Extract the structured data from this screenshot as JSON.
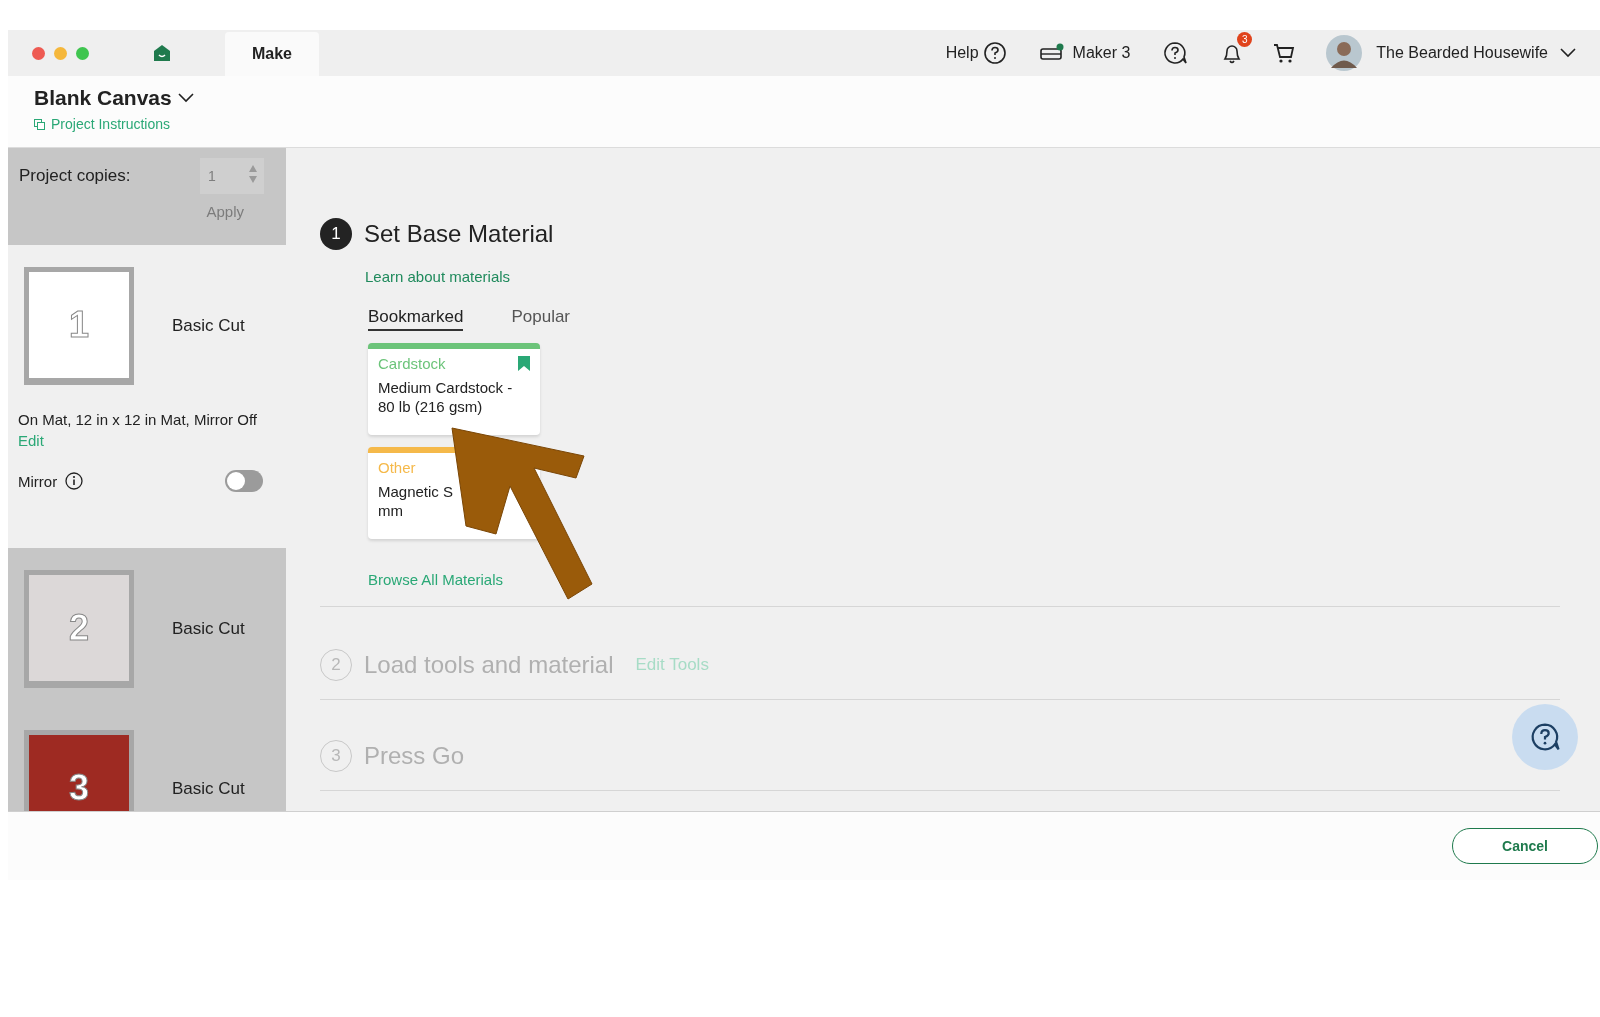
{
  "window": {
    "tabs": [
      {
        "label": "Make",
        "selected": true
      }
    ]
  },
  "top_bar": {
    "help": "Help",
    "machine": {
      "name": "Maker 3",
      "connected": true
    },
    "notifications": "3",
    "user": "The Bearded Housewife"
  },
  "project": {
    "title": "Blank Canvas",
    "instructions_link": "Project Instructions"
  },
  "sidebar": {
    "copies_label": "Project copies:",
    "copies_value": "1",
    "apply": "Apply",
    "apply_disabled": true,
    "mats": [
      {
        "number": "1",
        "label": "Basic Cut",
        "selected": true,
        "color": "#ffffff",
        "details": "On Mat, 12 in x 12 in Mat, Mirror Off",
        "edit": "Edit",
        "mirror_label": "Mirror",
        "mirror_on": false
      },
      {
        "number": "2",
        "label": "Basic Cut",
        "selected": false,
        "color": "#dcd8d8"
      },
      {
        "number": "3",
        "label": "Basic Cut",
        "selected": false,
        "color": "#9e2a22"
      }
    ]
  },
  "steps": [
    {
      "number": "1",
      "title": "Set Base Material",
      "active": true,
      "link": "Learn about materials"
    },
    {
      "number": "2",
      "title": "Load tools and material",
      "active": false,
      "link": "Edit Tools"
    },
    {
      "number": "3",
      "title": "Press Go",
      "active": false
    }
  ],
  "material_tabs": [
    {
      "label": "Bookmarked",
      "selected": true
    },
    {
      "label": "Popular",
      "selected": false
    }
  ],
  "materials": [
    {
      "category": "Cardstock",
      "color": "#6cc47a",
      "name_lines": [
        "Medium Cardstock -",
        "80 lb (216 gsm)"
      ],
      "bookmarked": true
    },
    {
      "category": "Other",
      "color": "#f5b94a",
      "name_lines": [
        "Magnetic S",
        "mm"
      ]
    }
  ],
  "browse_link": "Browse All Materials",
  "footer": {
    "cancel": "Cancel"
  }
}
